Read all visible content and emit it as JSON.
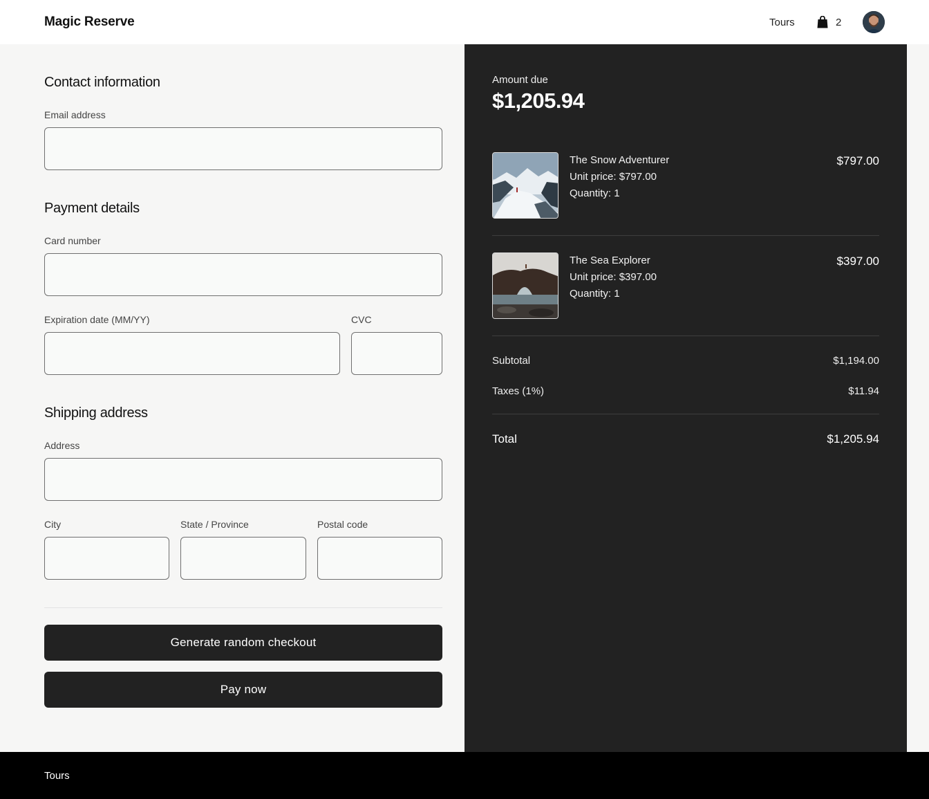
{
  "header": {
    "brand": "Magic Reserve",
    "nav_tours": "Tours",
    "cart_count": "2",
    "cart_icon": "shopping-bag-icon"
  },
  "contact": {
    "title": "Contact information",
    "email_label": "Email address",
    "email_value": ""
  },
  "payment": {
    "title": "Payment details",
    "card_label": "Card number",
    "card_value": "",
    "expiry_label": "Expiration date (MM/YY)",
    "expiry_value": "",
    "cvc_label": "CVC",
    "cvc_value": ""
  },
  "shipping": {
    "title": "Shipping address",
    "address_label": "Address",
    "address_value": "",
    "city_label": "City",
    "city_value": "",
    "state_label": "State / Province",
    "state_value": "",
    "postal_label": "Postal code",
    "postal_value": ""
  },
  "actions": {
    "generate_label": "Generate random checkout",
    "pay_label": "Pay now"
  },
  "summary": {
    "amount_label": "Amount due",
    "amount_value": "$1,205.94",
    "items": [
      {
        "name": "The Snow Adventurer",
        "unit_price": "Unit price: $797.00",
        "quantity": "Quantity: 1",
        "price": "$797.00"
      },
      {
        "name": "The Sea Explorer",
        "unit_price": "Unit price: $397.00",
        "quantity": "Quantity: 1",
        "price": "$397.00"
      }
    ],
    "subtotal_label": "Subtotal",
    "subtotal_value": "$1,194.00",
    "taxes_label": "Taxes (1%)",
    "taxes_value": "$11.94",
    "total_label": "Total",
    "total_value": "$1,205.94"
  },
  "footer": {
    "tours": "Tours"
  },
  "colors": {
    "panel_dark": "#222222",
    "page_bg": "#f6f6f5",
    "footer_bg": "#000000",
    "button_bg": "#222222"
  }
}
